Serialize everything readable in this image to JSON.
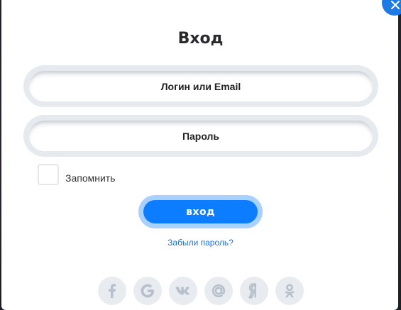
{
  "modal": {
    "title": "Вход"
  },
  "login_field": {
    "placeholder": "Логин или Email"
  },
  "password_field": {
    "placeholder": "Пароль"
  },
  "remember": {
    "label": "Запомнить",
    "checked": false
  },
  "submit": {
    "label": "вход"
  },
  "forgot_link": {
    "label": "Забыли пароль?"
  },
  "social_icons": [
    "facebook-icon",
    "google-icon",
    "vk-icon",
    "mail-at-icon",
    "yandex-icon",
    "odnoklassniki-icon"
  ],
  "colors": {
    "accent": "#0c7dff",
    "close_button": "#1e7be6",
    "link": "#1a73d9",
    "social_icon": "#b7c0cb"
  }
}
